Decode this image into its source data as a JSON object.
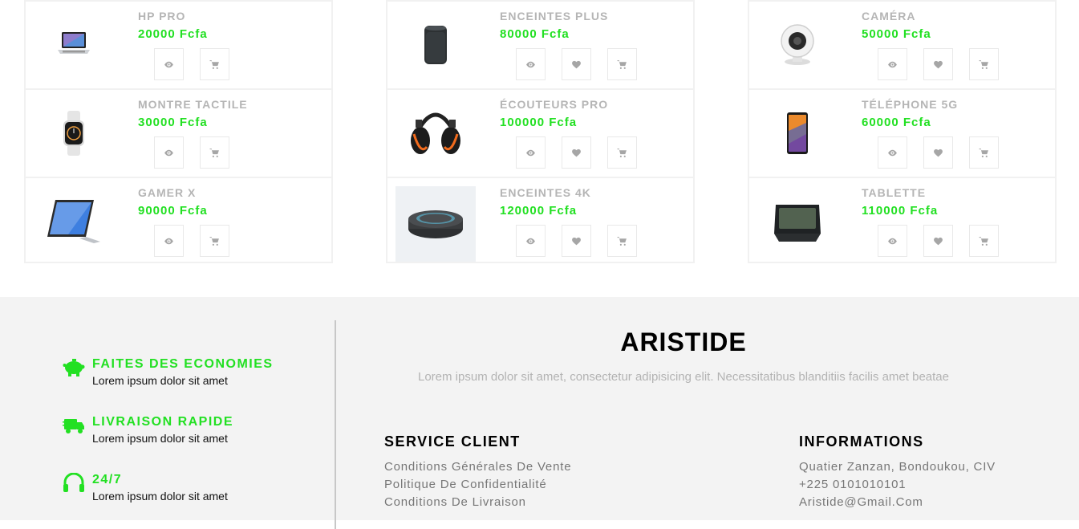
{
  "products": {
    "columns": [
      {
        "has_wishlist": false,
        "items": [
          {
            "name": "HP PRO",
            "price": "20000 Fcfa",
            "image": "laptop"
          },
          {
            "name": "MONTRE TACTILE",
            "price": "30000 Fcfa",
            "image": "smartwatch"
          },
          {
            "name": "GAMER X",
            "price": "90000 Fcfa",
            "image": "tablet-pc"
          }
        ]
      },
      {
        "has_wishlist": true,
        "items": [
          {
            "name": "ENCEINTES PLUS",
            "price": "80000 Fcfa",
            "image": "smart-speaker"
          },
          {
            "name": "ÉCOUTEURS PRO",
            "price": "100000 Fcfa",
            "image": "ear-defenders"
          },
          {
            "name": "ENCEINTES 4K",
            "price": "120000 Fcfa",
            "image": "echo-dot"
          }
        ]
      },
      {
        "has_wishlist": true,
        "items": [
          {
            "name": "CAMÉRA",
            "price": "50000 Fcfa",
            "image": "security-camera"
          },
          {
            "name": "TÉLÉPHONE 5G",
            "price": "60000 Fcfa",
            "image": "smartphone"
          },
          {
            "name": "TABLETTE",
            "price": "110000 Fcfa",
            "image": "smart-display"
          }
        ]
      }
    ],
    "icons": {
      "view": "eye-icon",
      "wishlist": "heart-icon",
      "cart": "cart-icon"
    }
  },
  "footer": {
    "features": [
      {
        "title": "FAITES DES ECONOMIES",
        "desc": "Lorem ipsum dolor sit amet",
        "icon": "piggy-bank-icon"
      },
      {
        "title": "LIVRAISON RAPIDE",
        "desc": "Lorem ipsum dolor sit amet",
        "icon": "delivery-truck-icon"
      },
      {
        "title": "24/7",
        "desc": "Lorem ipsum dolor sit amet",
        "icon": "headset-icon"
      }
    ],
    "brand": "ARISTIDE",
    "tagline": "Lorem ipsum dolor sit amet, consectetur adipisicing elit. Necessitatibus blanditiis facilis amet beatae",
    "service": {
      "title": "SERVICE CLIENT",
      "links": [
        "Conditions Générales De Vente",
        "Politique De Confidentialité",
        "Conditions De Livraison"
      ]
    },
    "info": {
      "title": "INFORMATIONS",
      "lines": [
        "Quatier Zanzan, Bondoukou, CIV",
        "+225 0101010101",
        "Aristide@Gmail.Com"
      ]
    }
  },
  "colors": {
    "accent": "#22e022",
    "muted": "#b5b5b5",
    "footer_bg": "#f3f3f3"
  }
}
